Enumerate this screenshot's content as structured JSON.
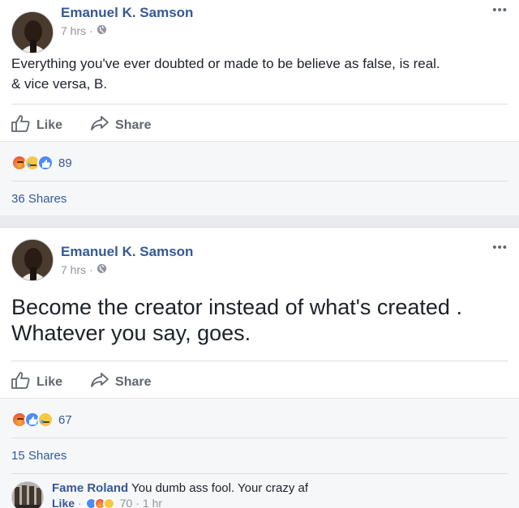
{
  "posts": [
    {
      "author": "Emanuel K. Samson",
      "time": "7 hrs",
      "dot": "·",
      "more": "•••",
      "text_line1": "Everything you've ever doubted or made to be believe as false, is real.",
      "text_line2": "& vice versa, B.",
      "like_label": "Like",
      "share_label": "Share",
      "reaction_count": "89",
      "shares": "36 Shares"
    },
    {
      "author": "Emanuel K. Samson",
      "time": "7 hrs",
      "dot": "·",
      "more": "•••",
      "text_line1": "Become the creator instead of what's created .",
      "text_line2": "Whatever you say, goes.",
      "like_label": "Like",
      "share_label": "Share",
      "reaction_count": "67",
      "shares": "15 Shares"
    }
  ],
  "comment": {
    "author": "Fame Roland",
    "text": "You dumb ass fool. Your crazy af",
    "like_label": "Like",
    "dot": "·",
    "reaction_count": "70",
    "time": "1 hr"
  },
  "colors": {
    "link": "#365899",
    "meta": "#90949c",
    "action": "#606770",
    "bg": "#e9ebee"
  }
}
